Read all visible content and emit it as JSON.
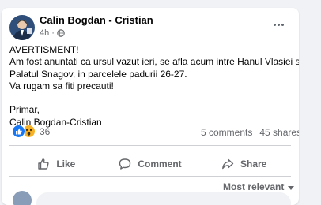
{
  "post": {
    "author": "Calin Bogdan - Cristian",
    "time": "4h",
    "visibility_icon": "globe-icon",
    "more_icon": "more-options-icon",
    "text_lines": [
      "AVERTISMENT!",
      "Am fost anuntati ca ursul vazut ieri, se afla acum intre Hanul Vlasiei si",
      "Palatul Snagov, in parcelele padurii 26-27.",
      "Va rugam sa fiti precauti!",
      "",
      "Primar,",
      "Calin Bogdan-Cristian"
    ]
  },
  "reactions": {
    "icons": [
      "like-reaction-icon",
      "wow-reaction-icon"
    ],
    "count": "36",
    "comments": "5 comments",
    "shares": "45 shares"
  },
  "actions": {
    "like": "Like",
    "comment": "Comment",
    "share": "Share"
  },
  "comments": {
    "sort_label": "Most relevant"
  },
  "colors": {
    "page_background": "#f0f2f5",
    "card_background": "#ffffff",
    "secondary_text": "#65676b",
    "like_blue": "#1877f2",
    "wow_yellow": "#f7b125"
  }
}
